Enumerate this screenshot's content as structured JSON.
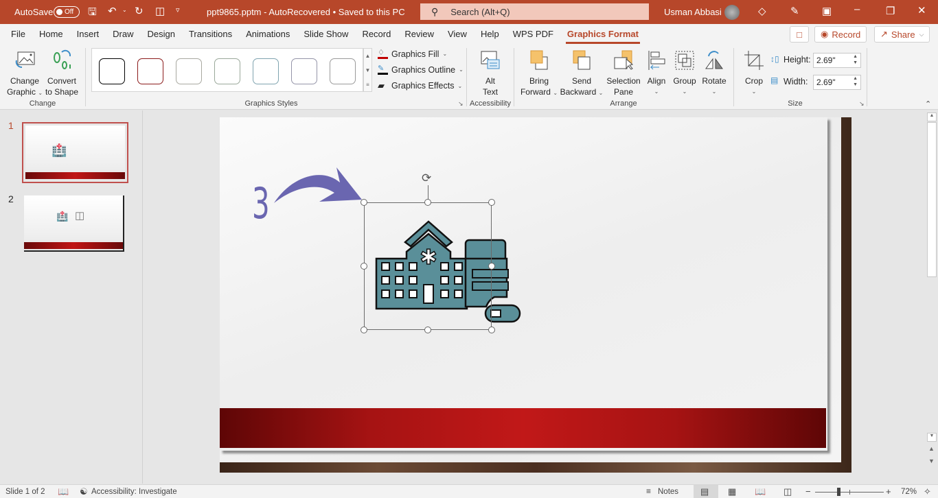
{
  "titlebar": {
    "autosave_label": "AutoSave",
    "autosave_state": "Off",
    "filename": "ppt9865.pptm",
    "status": "AutoRecovered",
    "save_status": "Saved to this PC",
    "search_placeholder": "Search (Alt+Q)",
    "user_name": "Usman Abbasi",
    "accent_color": "#b7472a"
  },
  "tabs": [
    {
      "label": "File"
    },
    {
      "label": "Home"
    },
    {
      "label": "Insert"
    },
    {
      "label": "Draw"
    },
    {
      "label": "Design"
    },
    {
      "label": "Transitions"
    },
    {
      "label": "Animations"
    },
    {
      "label": "Slide Show"
    },
    {
      "label": "Record"
    },
    {
      "label": "Review"
    },
    {
      "label": "View"
    },
    {
      "label": "Help"
    },
    {
      "label": "WPS PDF"
    },
    {
      "label": "Graphics Format",
      "active": true
    }
  ],
  "tab_actions": {
    "record": "Record",
    "share": "Share"
  },
  "ribbon": {
    "change": {
      "group_label": "Change",
      "change_graphic_1": "Change",
      "change_graphic_2": "Graphic",
      "convert_1": "Convert",
      "convert_2": "to Shape"
    },
    "graphics_styles": {
      "group_label": "Graphics Styles",
      "style_colors": [
        "#000000",
        "#8b1a1a",
        "#9a9a9a",
        "#8fa08f",
        "#6f9aa8",
        "#8888a0",
        "#8a8a8a"
      ],
      "fill": "Graphics Fill",
      "outline": "Graphics Outline",
      "effects": "Graphics Effects"
    },
    "accessibility": {
      "group_label": "Accessibility",
      "alt_text_1": "Alt",
      "alt_text_2": "Text"
    },
    "arrange": {
      "group_label": "Arrange",
      "bring_forward_1": "Bring",
      "bring_forward_2": "Forward",
      "send_backward_1": "Send",
      "send_backward_2": "Backward",
      "selection_pane_1": "Selection",
      "selection_pane_2": "Pane",
      "align": "Align",
      "group": "Group",
      "rotate": "Rotate"
    },
    "size": {
      "group_label": "Size",
      "crop": "Crop",
      "height_label": "Height:",
      "height_value": "2.69\"",
      "width_label": "Width:",
      "width_value": "2.69\""
    }
  },
  "thumbnails": [
    {
      "number": "1",
      "selected": true
    },
    {
      "number": "2",
      "selected": false
    }
  ],
  "slide": {
    "step_number": "3",
    "arrow_color": "#6a66b0",
    "icon_color": "#5a8f99"
  },
  "statusbar": {
    "slide_info": "Slide 1 of 2",
    "accessibility": "Accessibility: Investigate",
    "notes": "Notes",
    "zoom": "72%",
    "zoom_fraction": 0.72
  }
}
